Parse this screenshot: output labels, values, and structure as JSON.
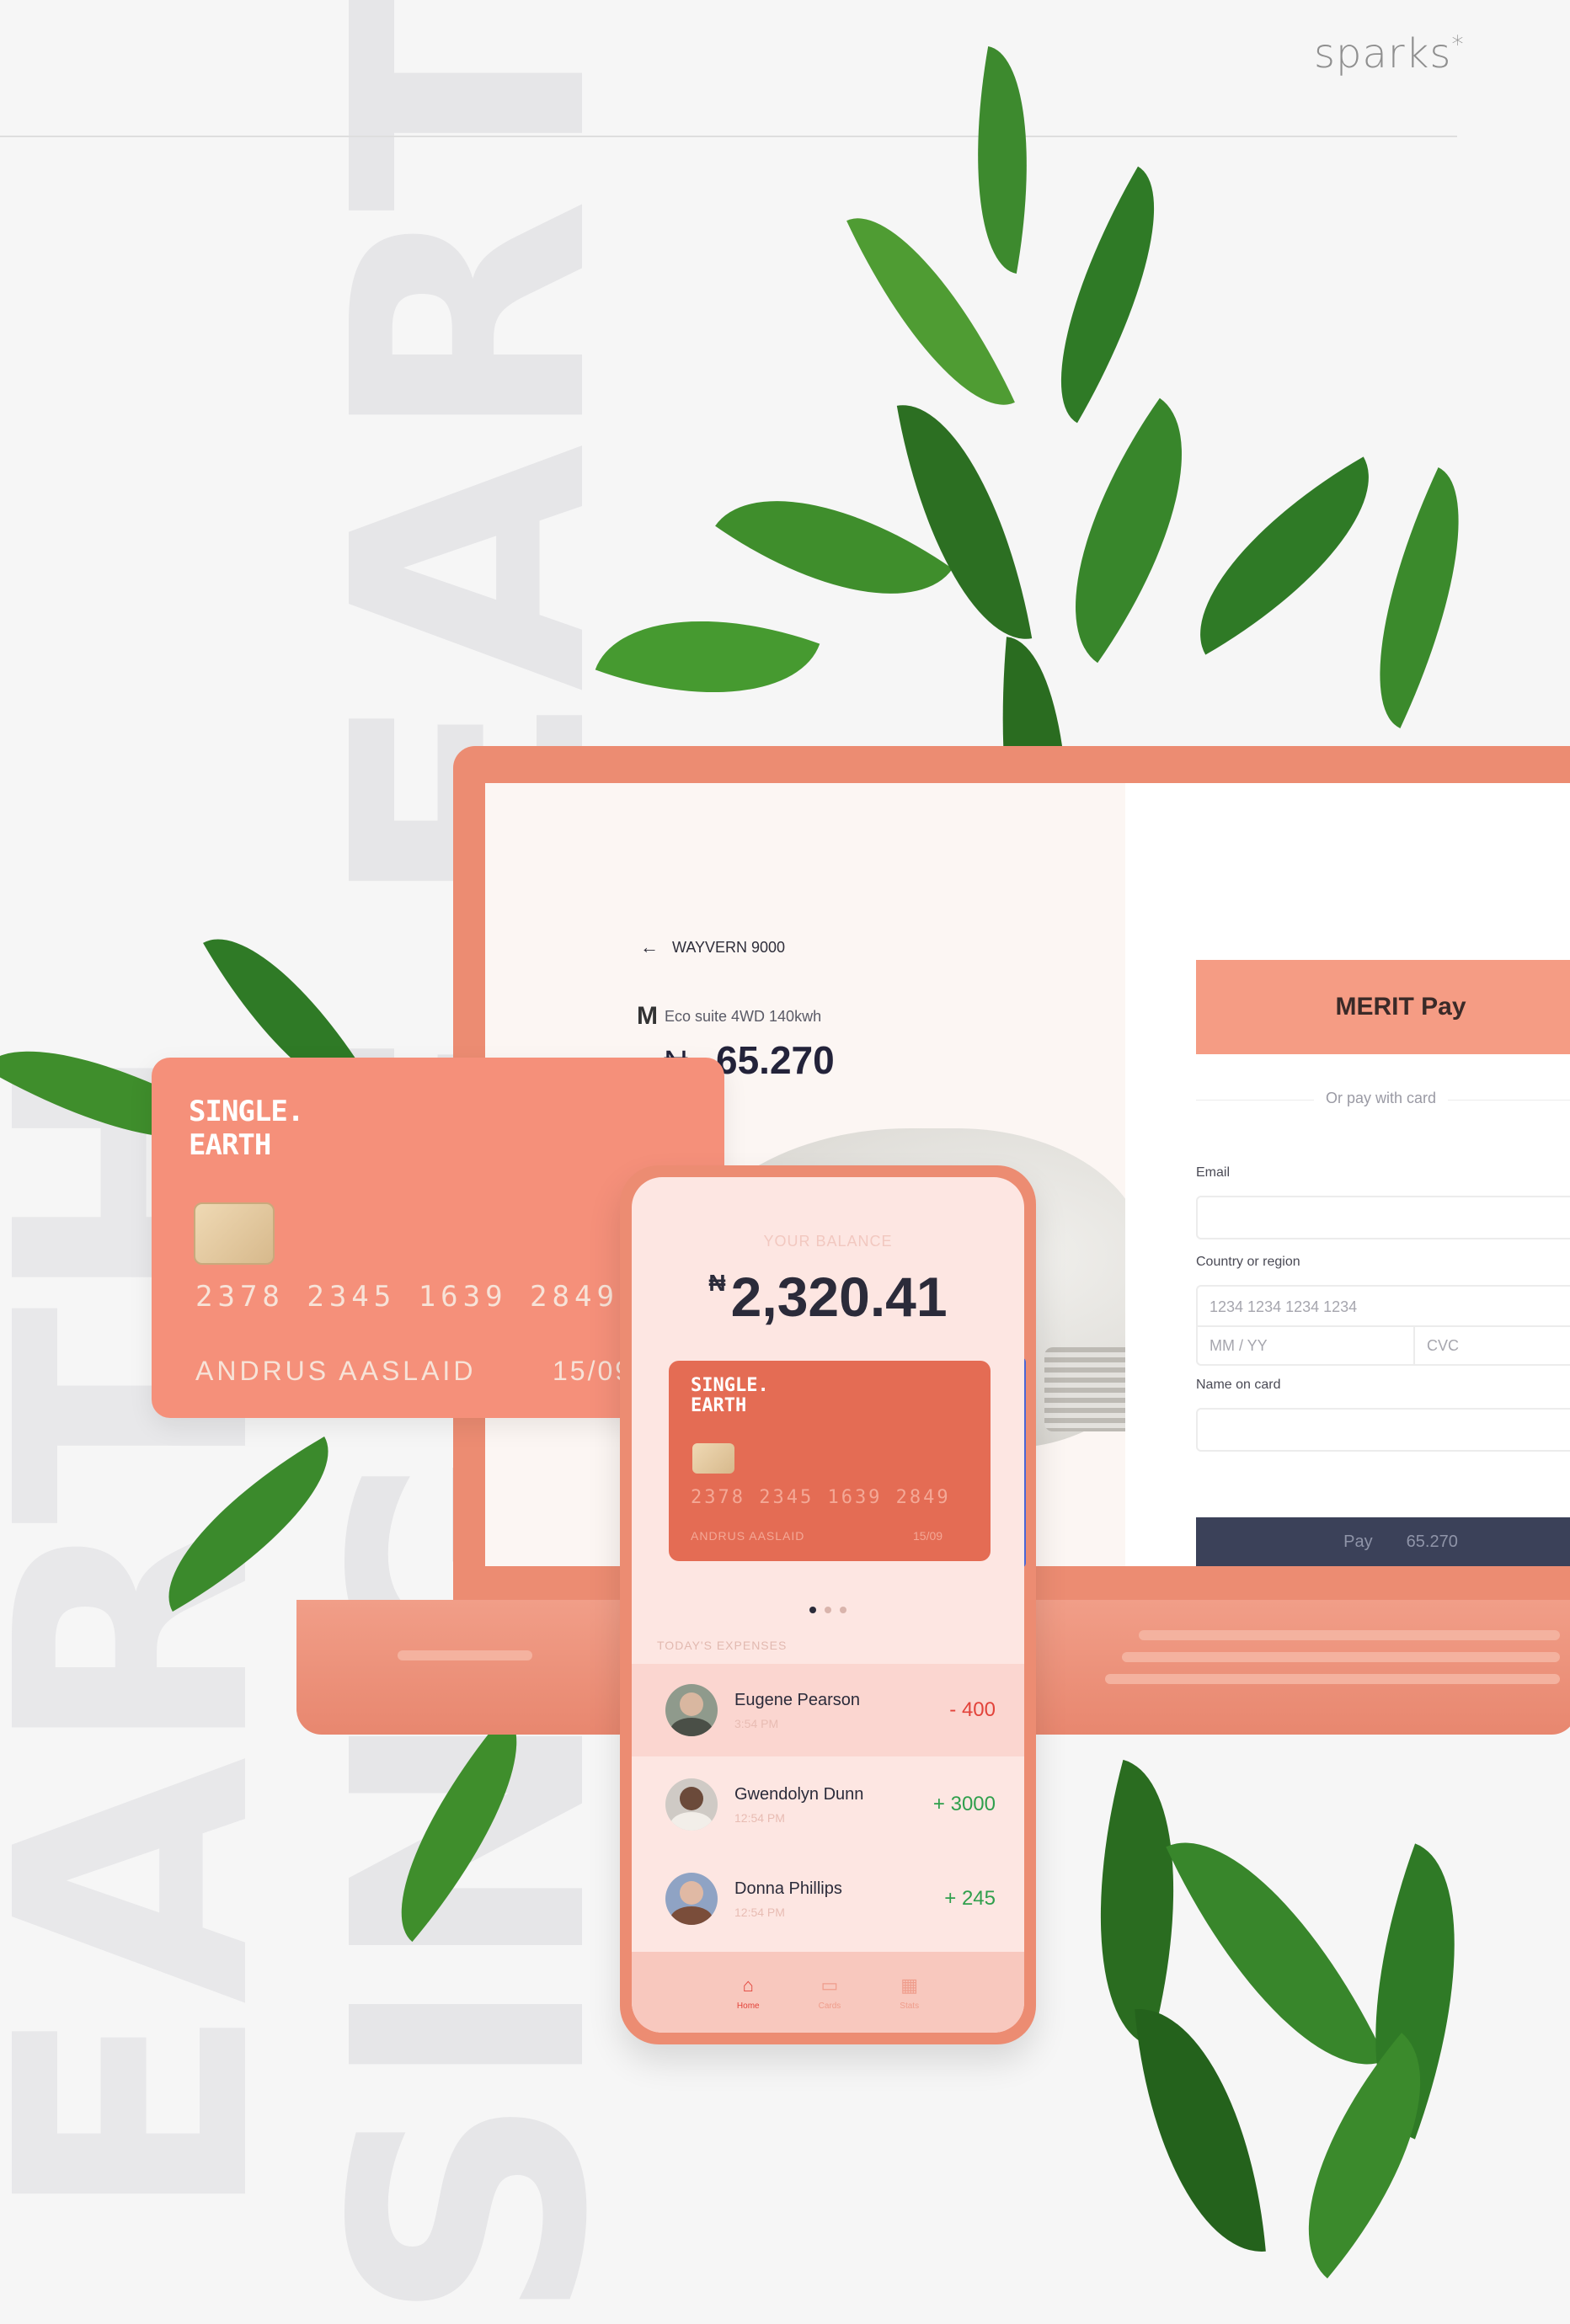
{
  "brand": {
    "name": "sparks",
    "mark": "*"
  },
  "background": {
    "words": [
      "EARTH",
      "SINGLE EARTH"
    ]
  },
  "checkout": {
    "back_label": "WAYVERN 9000",
    "product_logo": "M",
    "product_name": "Eco suite 4WD 140kwh",
    "price_currency": "₦",
    "price": "65.270",
    "merit_pay_label": "MERIT Pay",
    "or_label": "Or pay with card",
    "email_label": "Email",
    "country_label": "Country or region",
    "card_number_placeholder": "1234 1234 1234 1234",
    "expiry_placeholder": "MM / YY",
    "cvc_placeholder": "CVC",
    "name_label": "Name on card",
    "pay_label": "Pay",
    "pay_amount": "65.270"
  },
  "card": {
    "logo_line1": "SINGLE.",
    "logo_line2": "EARTH",
    "number": "2378 2345 1639 2849",
    "holder": "ANDRUS AASLAID",
    "expiry": "15/09"
  },
  "phone": {
    "balance_label": "YOUR BALANCE",
    "balance_currency": "₦",
    "balance": "2,320.41",
    "card": {
      "logo_line1": "SINGLE.",
      "logo_line2": "EARTH",
      "number": "2378 2345 1639 2849",
      "holder": "ANDRUS AASLAID",
      "expiry": "15/09"
    },
    "section_label": "TODAY'S EXPENSES",
    "transactions": [
      {
        "name": "Eugene Pearson",
        "time": "3:54 PM",
        "amount": "- 400"
      },
      {
        "name": "Gwendolyn Dunn",
        "time": "12:54 PM",
        "amount": "+ 3000"
      },
      {
        "name": "Donna Phillips",
        "time": "12:54 PM",
        "amount": "+ 245"
      }
    ],
    "tabs": [
      {
        "label": "Home",
        "icon": "home-icon"
      },
      {
        "label": "Cards",
        "icon": "card-icon"
      },
      {
        "label": "Stats",
        "icon": "stats-icon"
      }
    ]
  },
  "colors": {
    "coral": "#ec8c72",
    "card": "#f5907a",
    "navy": "#3b4159",
    "negative": "#e2433a",
    "positive": "#2f9f4c"
  }
}
